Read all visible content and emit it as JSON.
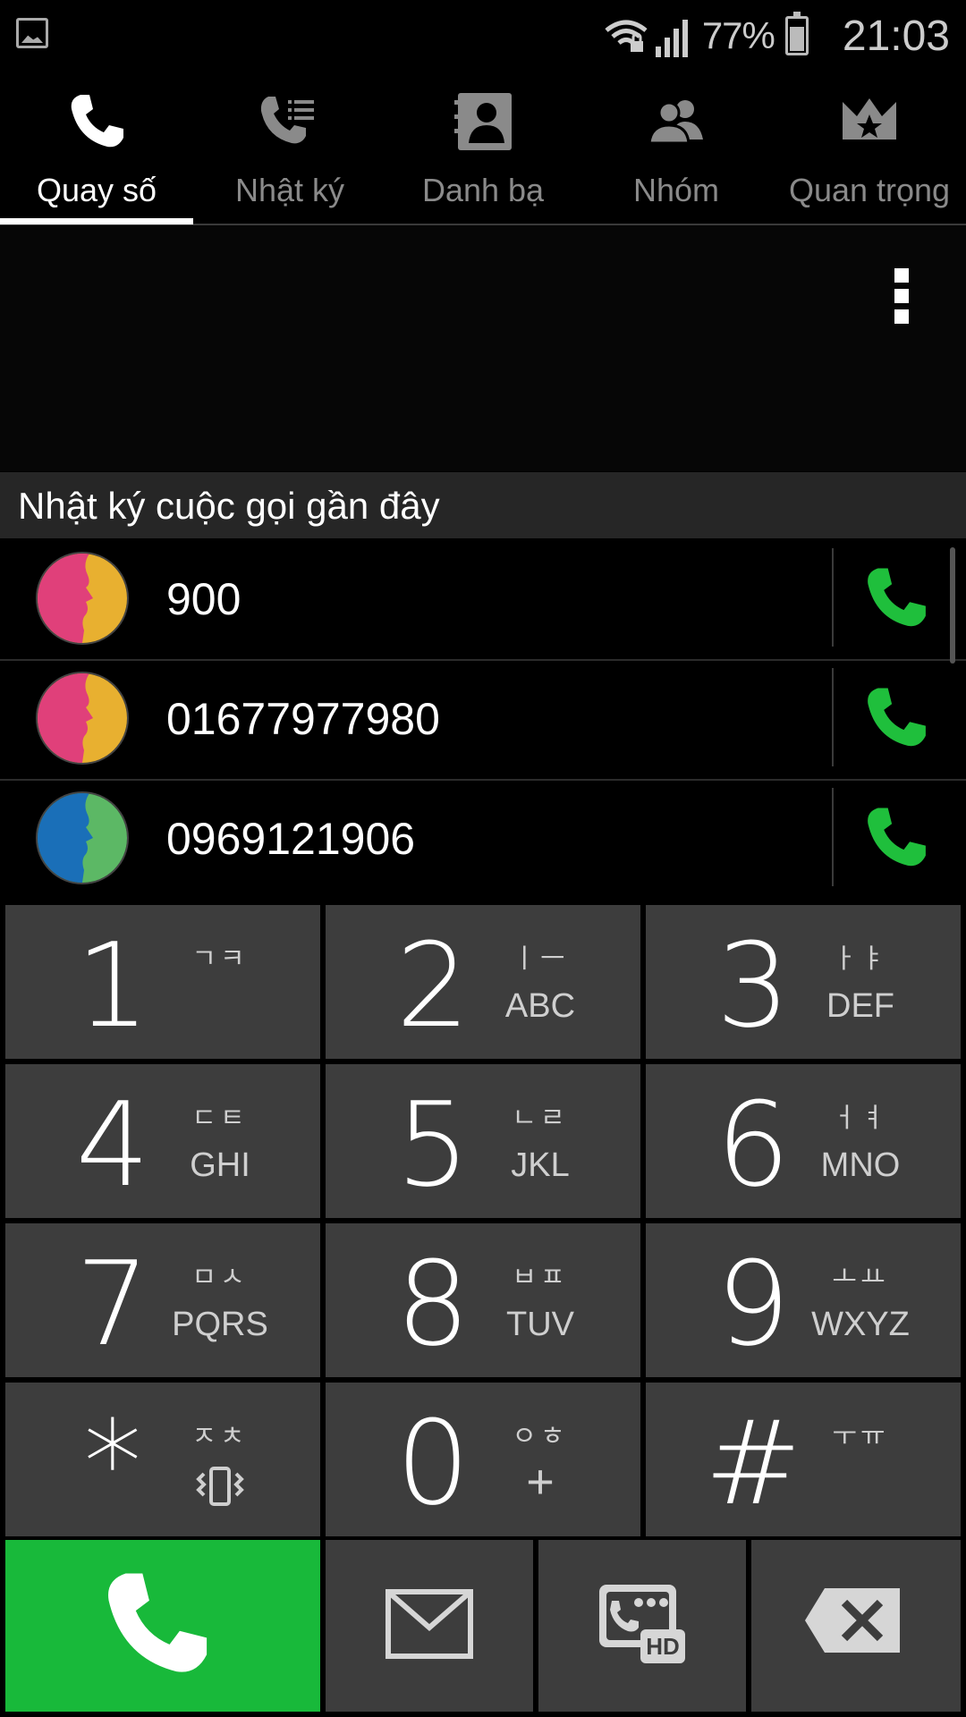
{
  "status": {
    "battery_percent": "77%",
    "time": "21:03"
  },
  "tabs": [
    {
      "label": "Quay số",
      "icon": "phone-icon",
      "active": true
    },
    {
      "label": "Nhật ký",
      "icon": "call-log-icon",
      "active": false
    },
    {
      "label": "Danh bạ",
      "icon": "contacts-book-icon",
      "active": false
    },
    {
      "label": "Nhóm",
      "icon": "group-icon",
      "active": false
    },
    {
      "label": "Quan trọng",
      "icon": "favorites-crown-icon",
      "active": false
    }
  ],
  "recent": {
    "header": "Nhật ký cuộc gọi gần đây",
    "items": [
      {
        "number": "900",
        "avatar_colors": [
          "#e0407a",
          "#e8b030"
        ]
      },
      {
        "number": "01677977980",
        "avatar_colors": [
          "#e0407a",
          "#e8b030"
        ]
      },
      {
        "number": "0969121906",
        "avatar_colors": [
          "#1a6fb8",
          "#5cb865"
        ]
      }
    ]
  },
  "keypad": {
    "keys": [
      {
        "digit": "1",
        "hangul": "ㄱㅋ",
        "letters": ""
      },
      {
        "digit": "2",
        "hangul": "ㅣㅡ",
        "letters": "ABC"
      },
      {
        "digit": "3",
        "hangul": "ㅏㅑ",
        "letters": "DEF"
      },
      {
        "digit": "4",
        "hangul": "ㄷㅌ",
        "letters": "GHI"
      },
      {
        "digit": "5",
        "hangul": "ㄴㄹ",
        "letters": "JKL"
      },
      {
        "digit": "6",
        "hangul": "ㅓㅕ",
        "letters": "MNO"
      },
      {
        "digit": "7",
        "hangul": "ㅁㅅ",
        "letters": "PQRS"
      },
      {
        "digit": "8",
        "hangul": "ㅂㅍ",
        "letters": "TUV"
      },
      {
        "digit": "9",
        "hangul": "ㅗㅛ",
        "letters": "WXYZ"
      },
      {
        "digit": "*",
        "hangul": "ㅈㅊ",
        "letters": ""
      },
      {
        "digit": "0",
        "hangul": "ㅇㅎ",
        "letters": "+"
      },
      {
        "digit": "#",
        "hangul": "ㅜㅠ",
        "letters": ""
      }
    ]
  },
  "actions": {
    "dial_color": "#18b93a",
    "call_icon_color": "#1fbf3c"
  }
}
